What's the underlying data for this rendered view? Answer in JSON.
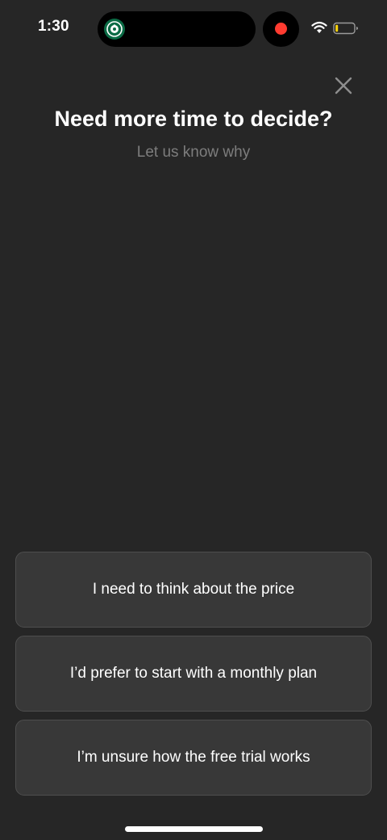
{
  "status_bar": {
    "time": "1:30",
    "island_app_icon": "starbucks-logo-icon",
    "recording_indicator_color": "#ff3b30",
    "wifi_icon": "wifi-icon",
    "battery_icon": "battery-low-icon"
  },
  "header": {
    "close_icon": "close-icon",
    "title": "Need more time to decide?",
    "subtitle": "Let us know why"
  },
  "options": [
    {
      "label": "I need to think about the price"
    },
    {
      "label": "I’d prefer to start with a monthly plan"
    },
    {
      "label": "I’m unsure how the free trial works"
    }
  ],
  "colors": {
    "background": "#262626",
    "option_background": "#383838",
    "subtitle_text": "#7d7d7d"
  }
}
